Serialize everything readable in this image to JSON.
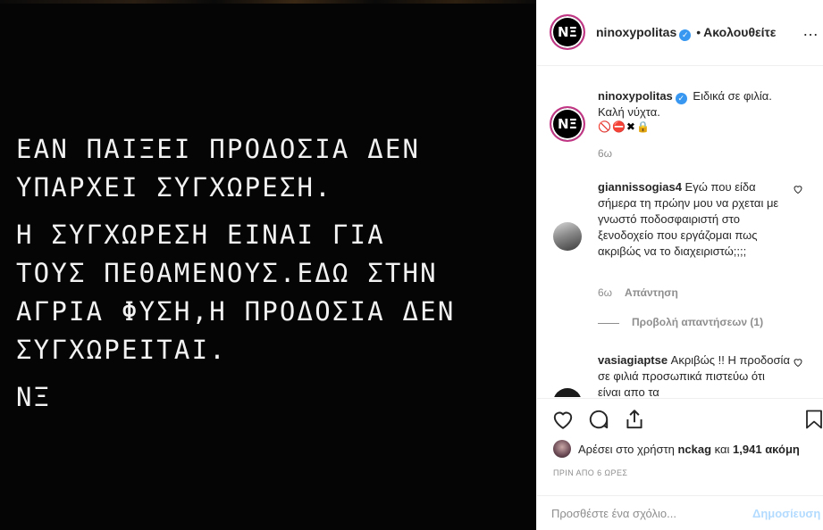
{
  "story": {
    "paragraphs": [
      [
        "ΕΑΝ ΠΑΙΞΕΙ ΠΡΟΔΟΣΙΑ ΔΕΝ",
        "ΥΠΑΡΧΕΙ ΣΥΓΧΩΡΕΣΗ."
      ],
      [
        "Η ΣΥΓΧΩΡΕΣΗ ΕΙΝΑΙ ΓΙΑ",
        "ΤΟΥΣ ΠΕΘΑΜΕΝΟΥΣ.ΕΔΩ ΣΤΗΝ",
        "ΑΓΡΙΑ ΦΥΣΗ,Η ΠΡΟΔΟΣΙΑ ΔΕΝ",
        "ΣΥΓΧΩΡΕΙΤΑΙ."
      ],
      [
        "ΝΞ"
      ]
    ]
  },
  "header": {
    "avatar_text": "ΝΞ",
    "username": "ninoxypolitas",
    "separator": "•",
    "follow_label": "Ακολουθείτε",
    "more_icon": "ellipsis-icon"
  },
  "caption": {
    "avatar_text": "ΝΞ",
    "username": "ninoxypolitas",
    "text_line1": "Ειδικά σε φιλία.",
    "text_line2": "Καλή νύχτα.",
    "emojis": "🚫⛔✖🔒",
    "time": "6ω"
  },
  "comments": [
    {
      "username": "giannissogias4",
      "text": "Εγώ που είδα σήμερα τη πρώην μου να ρχεται με γνωστό ποδοσφαιριστή στο ξενοδοχείο που εργάζομαι πως ακριβώς να το διαχειριστώ;;;;",
      "time": "6ω",
      "reply_label": "Απάντηση",
      "view_replies_label": "Προβολή απαντήσεων (1)"
    },
    {
      "username": "vasiagiaptse",
      "text": "Ακριβώς !! Η προδοσία σε φιλιά προσωπικά πιστεύω ότι είναι απο τα"
    }
  ],
  "likes": {
    "prefix": "Αρέσει στο χρήστη",
    "user": "nckag",
    "middle": "και",
    "count": "1,941 ακόμη"
  },
  "post_time": "ΠΡΙΝ ΑΠΟ 6 ΩΡΕΣ",
  "comment_box": {
    "placeholder": "Προσθέστε ένα σχόλιο...",
    "post_label": "Δημοσίευση"
  },
  "colors": {
    "verified": "#3897f0",
    "post_button_disabled": "#b3dbff",
    "meta": "#8e8e8e"
  }
}
